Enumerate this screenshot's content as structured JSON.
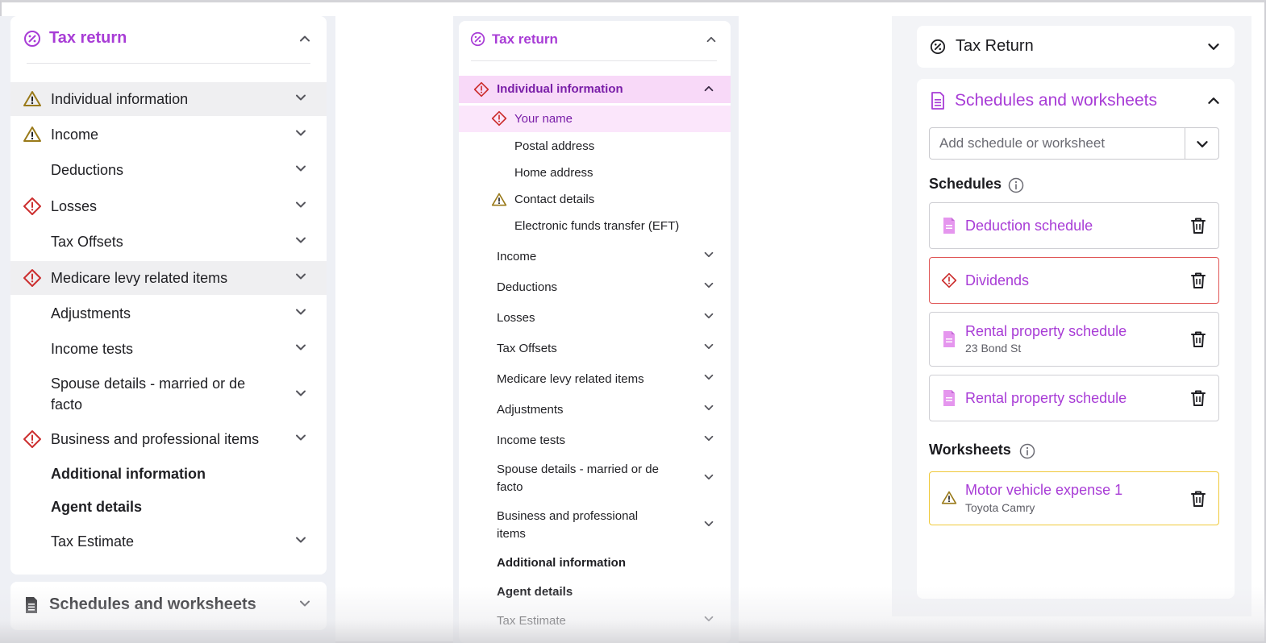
{
  "panel1": {
    "title": "Tax return",
    "items": [
      {
        "label": "Individual information",
        "status": "warning"
      },
      {
        "label": "Income",
        "status": "warning"
      },
      {
        "label": "Deductions",
        "status": ""
      },
      {
        "label": "Losses",
        "status": "error"
      },
      {
        "label": "Tax Offsets",
        "status": ""
      },
      {
        "label": "Medicare levy related items",
        "status": "error"
      },
      {
        "label": "Adjustments",
        "status": ""
      },
      {
        "label": "Income tests",
        "status": ""
      },
      {
        "label": "Spouse details - married or de",
        "label2": "facto",
        "status": ""
      },
      {
        "label": "Business and professional items",
        "status": "error"
      },
      {
        "label": "Additional information",
        "status": ""
      },
      {
        "label": "Agent details",
        "status": ""
      },
      {
        "label": "Tax Estimate",
        "status": ""
      }
    ],
    "footer_title": "Schedules and worksheets"
  },
  "panel2": {
    "title": "Tax return",
    "section": "Individual information",
    "subitems": [
      {
        "label": "Your name",
        "status": "error"
      },
      {
        "label": "Postal address",
        "status": ""
      },
      {
        "label": "Home address",
        "status": ""
      },
      {
        "label": "Contact details",
        "status": "warning"
      },
      {
        "label": "Electronic funds transfer (EFT)",
        "status": ""
      }
    ],
    "items": [
      {
        "label": "Income"
      },
      {
        "label": "Deductions"
      },
      {
        "label": "Losses"
      },
      {
        "label": "Tax Offsets"
      },
      {
        "label": "Medicare levy related items"
      },
      {
        "label": "Adjustments"
      },
      {
        "label": "Income tests"
      },
      {
        "label": "Spouse details - married or de",
        "label2": "facto"
      },
      {
        "label": "Business and professional",
        "label2": "items"
      },
      {
        "label": "Additional information"
      },
      {
        "label": "Agent details"
      },
      {
        "label": "Tax Estimate"
      }
    ]
  },
  "panel3": {
    "top_title": "Tax Return",
    "section_title": "Schedules and worksheets",
    "add_placeholder": "Add schedule or worksheet",
    "schedules_label": "Schedules",
    "schedules": [
      {
        "name": "Deduction schedule",
        "sub": "",
        "status": ""
      },
      {
        "name": "Dividends",
        "sub": "",
        "status": "error"
      },
      {
        "name": "Rental property schedule",
        "sub": "23 Bond St",
        "status": ""
      },
      {
        "name": "Rental property schedule",
        "sub": "",
        "status": ""
      }
    ],
    "worksheets_label": "Worksheets",
    "worksheets": [
      {
        "name": "Motor vehicle expense 1",
        "sub": "Toyota Camry",
        "status": "warning"
      }
    ]
  },
  "colors": {
    "accent": "#a83cd6",
    "error": "#cc2f2f",
    "warning": "#9a7a1a",
    "highlight": "#f8d9f8"
  }
}
